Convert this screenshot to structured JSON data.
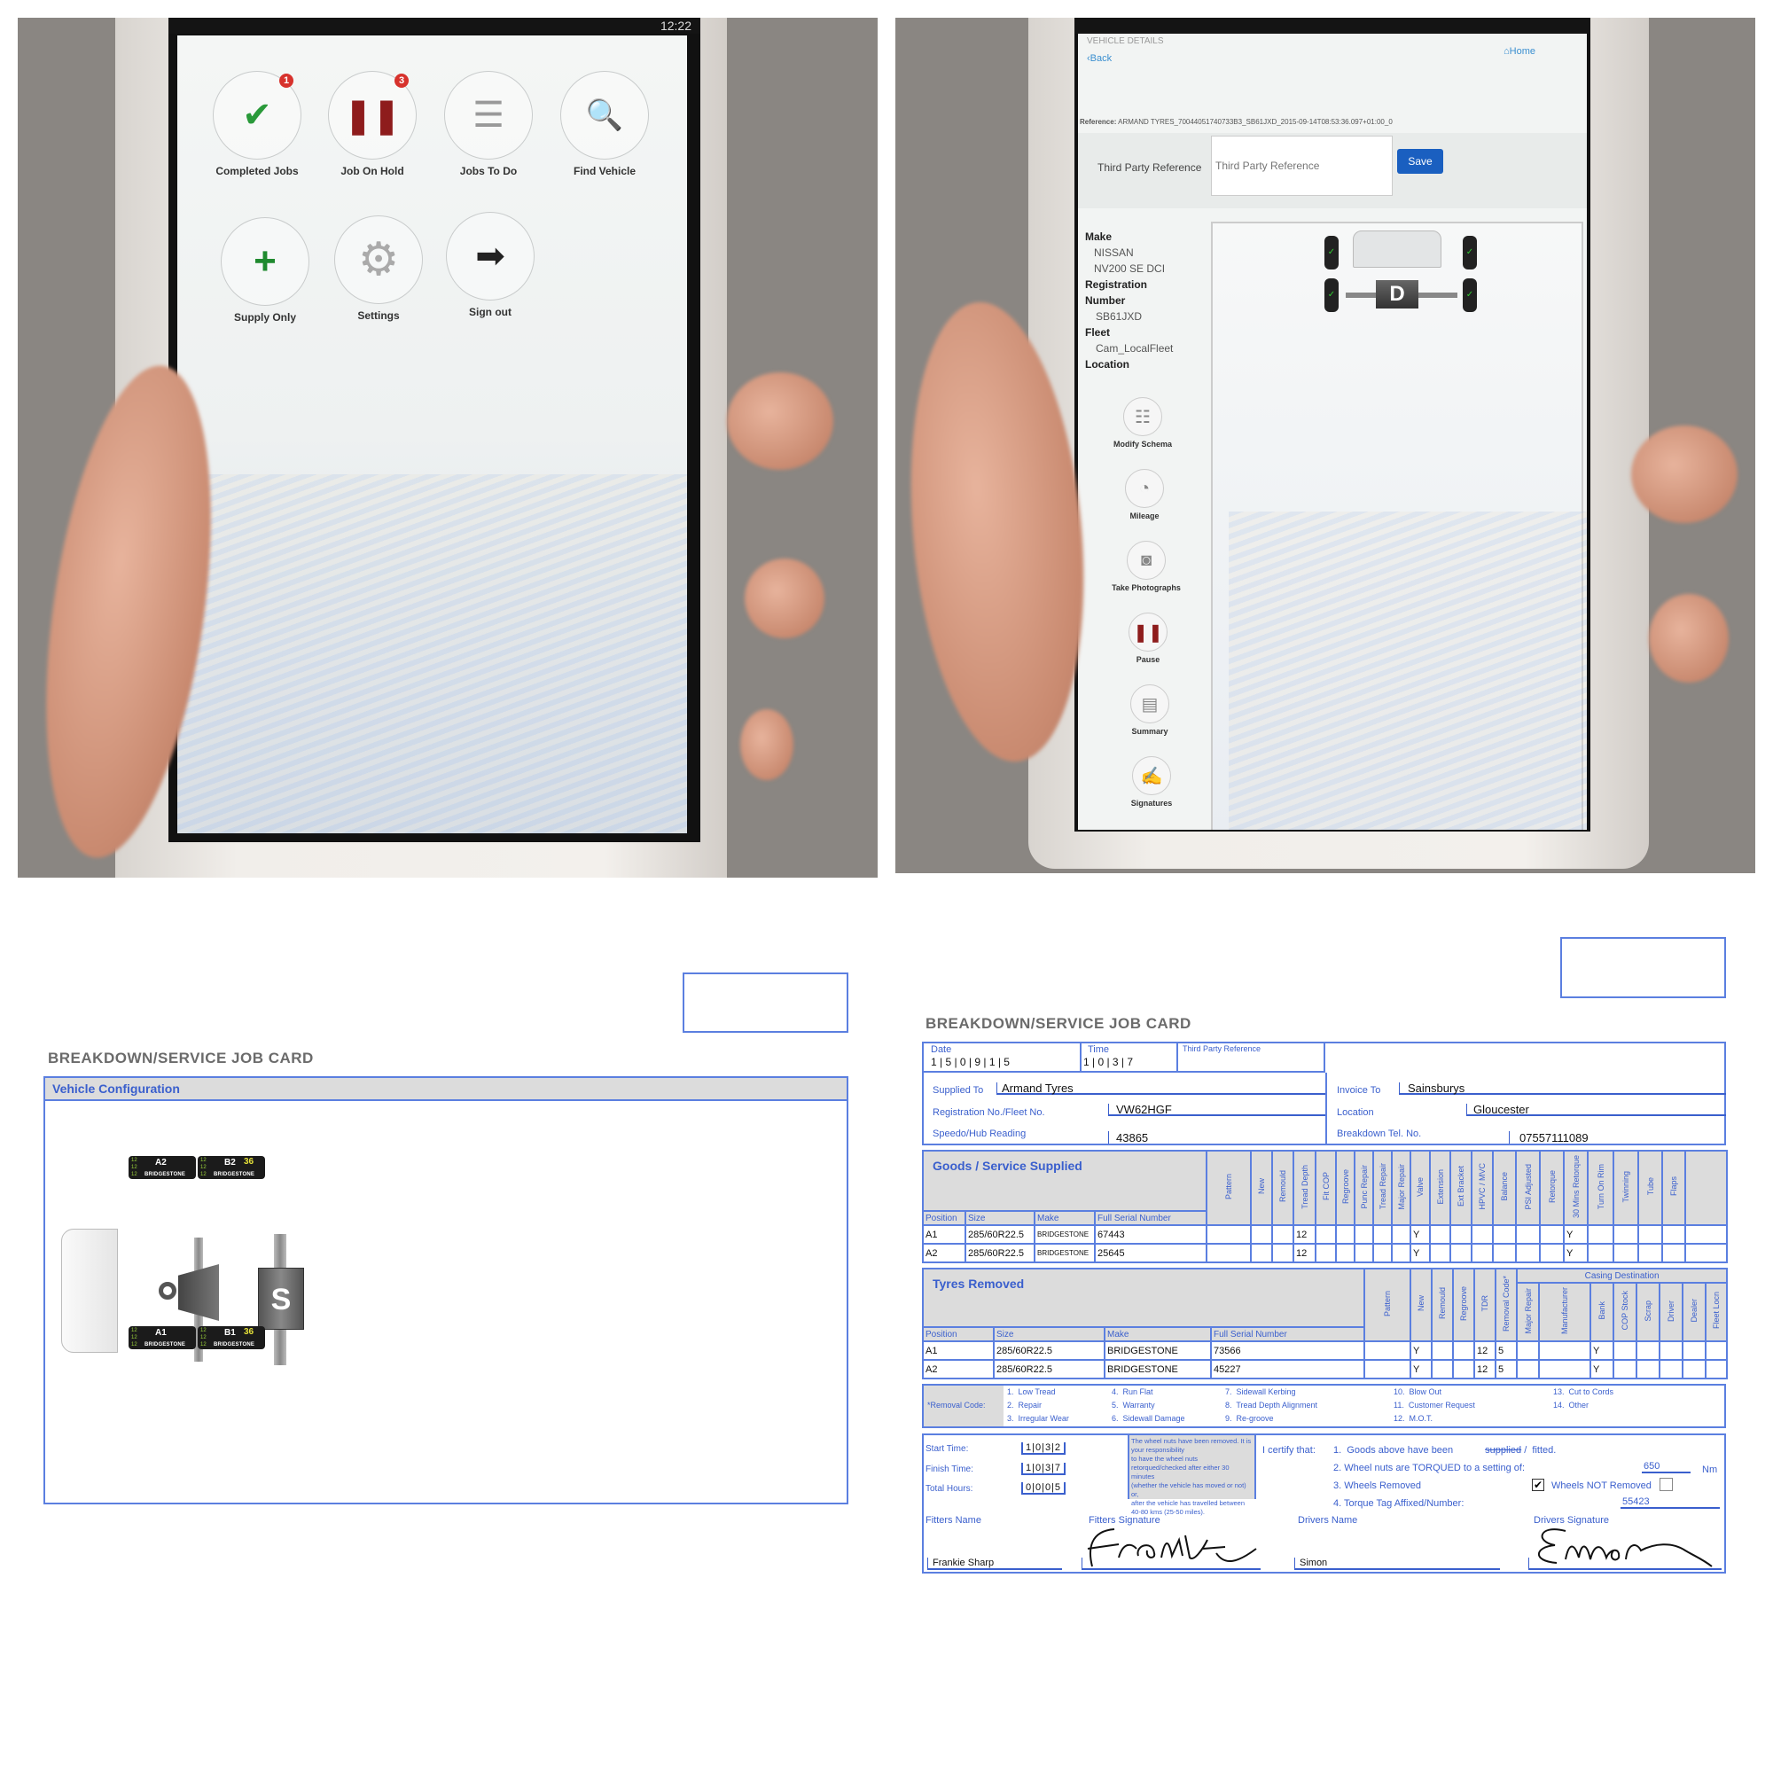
{
  "photo1": {
    "status_time": "12:22",
    "tiles": [
      {
        "label": "Completed Jobs",
        "badge": "1",
        "icon": "clipboard-check-icon"
      },
      {
        "label": "Job On Hold",
        "badge": "3",
        "icon": "clipboard-pause-icon"
      },
      {
        "label": "Jobs To Do",
        "badge": "",
        "icon": "clipboard-list-icon"
      },
      {
        "label": "Find Vehicle",
        "badge": "",
        "icon": "truck-search-icon"
      },
      {
        "label": "Supply Only",
        "badge": "",
        "icon": "clipboard-plus-icon"
      },
      {
        "label": "Settings",
        "badge": "",
        "icon": "gear-icon"
      },
      {
        "label": "Sign out",
        "badge": "",
        "icon": "sign-out-icon"
      }
    ]
  },
  "photo2": {
    "section_title": "VEHICLE DETAILS",
    "back_label": "Back",
    "home_label": "Home",
    "reference_label": "Reference:",
    "reference_value": "ARMAND TYRES_70044051740733B3_SB61JXD_2015-09-14T08:53:36.097+01:00_0",
    "third_party_label": "Third Party Reference",
    "third_party_placeholder": "Third Party Reference",
    "save_label": "Save",
    "save_color": "#1a5fc0",
    "details": {
      "make_label": "Make",
      "make": "NISSAN",
      "model": "NV200 SE DCI",
      "registration_label": "Registration",
      "number_label": "Number",
      "registration": "SB61JXD",
      "fleet_label": "Fleet",
      "fleet": "Cam_LocalFleet",
      "location_label": "Location"
    },
    "actions": [
      "Modify Schema",
      "Mileage",
      "Take Photographs",
      "Pause",
      "Summary",
      "Signatures"
    ],
    "axle_letter": "D"
  },
  "doc1": {
    "title": "BREAKDOWN/SERVICE JOB CARD",
    "section": "Vehicle Configuration",
    "axle_letter": "S",
    "tags": [
      {
        "pos": "A2",
        "pressure": "",
        "depths": [
          "12",
          "12",
          "12"
        ],
        "brand": "BRIDGESTONE"
      },
      {
        "pos": "B2",
        "pressure": "36",
        "depths": [
          "12",
          "12",
          "12"
        ],
        "brand": "BRIDGESTONE"
      },
      {
        "pos": "A1",
        "pressure": "",
        "depths": [
          "12",
          "12",
          "12"
        ],
        "brand": "BRIDGESTONE"
      },
      {
        "pos": "B1",
        "pressure": "36",
        "depths": [
          "12",
          "12",
          "12"
        ],
        "brand": "BRIDGESTONE"
      }
    ]
  },
  "doc2": {
    "title": "BREAKDOWN/SERVICE JOB CARD",
    "header": {
      "date_label": "Date",
      "date": "1 | 5 | 0 | 9 | 1 | 5",
      "time_label": "Time",
      "time": "1 | 0 | 3 | 7",
      "third_party_label": "Third Party Reference",
      "supplied_to_label": "Supplied To",
      "supplied_to": "Armand Tyres",
      "invoice_to_label": "Invoice To",
      "invoice_to": "Sainsburys",
      "registration_label": "Registration No./Fleet No.",
      "registration": "VW62HGF",
      "location_label": "Location",
      "location": "Gloucester",
      "speedo_label": "Speedo/Hub Reading",
      "speedo": "43865",
      "tel_label": "Breakdown Tel. No.",
      "tel": "07557111089"
    },
    "goods": {
      "title": "Goods / Service Supplied",
      "base_columns": [
        "Position",
        "Size",
        "Make",
        "Full Serial Number"
      ],
      "service_columns": [
        "Pattern",
        "New",
        "Remould",
        "Tread Depth",
        "Fit COP",
        "Regroove",
        "Punc Repair",
        "Tread Repair",
        "Major Repair",
        "Valve",
        "Extension",
        "Ext Bracket",
        "HPVC / MVC",
        "Balance",
        "PSI Adjusted",
        "Retorque",
        "30 Mins Retorque",
        "Turn On Rim",
        "Twinning",
        "Tube",
        "Flaps",
        ""
      ],
      "rows": [
        {
          "cells": [
            "A1",
            "285/60R22.5",
            "BRIDGESTONE",
            "67443",
            "",
            "",
            "",
            "12",
            "",
            "",
            "",
            "",
            "",
            "Y",
            "",
            "",
            "",
            "",
            "",
            "",
            "Y",
            "",
            "",
            "",
            "",
            ""
          ]
        },
        {
          "cells": [
            "A2",
            "285/60R22.5",
            "BRIDGESTONE",
            "25645",
            "",
            "",
            "",
            "12",
            "",
            "",
            "",
            "",
            "",
            "Y",
            "",
            "",
            "",
            "",
            "",
            "",
            "Y",
            "",
            "",
            "",
            "",
            ""
          ]
        }
      ]
    },
    "removed": {
      "title": "Tyres Removed",
      "base_columns": [
        "Position",
        "Size",
        "Make",
        "Full Serial Number"
      ],
      "columns": [
        "Pattern",
        "New",
        "Remould",
        "Regroove",
        "TDR",
        "Removal Code*"
      ],
      "casing_title": "Casing Destination",
      "casing_columns": [
        "Major Repair",
        "Manufacturer",
        "Bank",
        "COP Stock",
        "Scrap",
        "Driver",
        "Dealer",
        "Fleet Locn"
      ],
      "rows": [
        {
          "cells": [
            "A1",
            "285/60R22.5",
            "BRIDGESTONE",
            "73566",
            "",
            "Y",
            "",
            "",
            "12",
            "5",
            "",
            "",
            "Y",
            "",
            "",
            "",
            "",
            ""
          ]
        },
        {
          "cells": [
            "A2",
            "285/60R22.5",
            "BRIDGESTONE",
            "45227",
            "",
            "Y",
            "",
            "",
            "12",
            "5",
            "",
            "",
            "Y",
            "",
            "",
            "",
            "",
            ""
          ]
        }
      ]
    },
    "removal_codes": {
      "label": "*Removal Code:",
      "codes": [
        "1.  Low Tread",
        "2.  Repair",
        "3.  Irregular Wear",
        "4.  Run Flat",
        "5.  Warranty",
        "6.  Sidewall Damage",
        "7.  Sidewall Kerbing",
        "8.  Tread Depth Alignment",
        "9.  Re-groove",
        "10.  Blow Out",
        "11.  Customer Request",
        "12.  M.O.T.",
        "13.  Cut to Cords",
        "14.  Other"
      ]
    },
    "footer": {
      "start_label": "Start Time:",
      "start": "1|0|3|2",
      "finish_label": "Finish Time:",
      "finish": "1|0|3|7",
      "total_label": "Total Hours:",
      "total": "0|0|0|5",
      "notice": [
        "The wheel nuts have been removed.  It is your responsibility",
        "to have the wheel nuts retorqued/checked after either 30 minutes",
        "(whether the vehicle has moved or not) or,",
        "after the vehicle has travelled between 40-80 kms (25-50 miles)."
      ],
      "certify_label": "I certify that:",
      "cert1": "1.  Goods above have been",
      "cert1_struck": "supplied",
      "cert1_end": "/  fitted.",
      "cert2": "2.  Wheel nuts are TORQUED to a setting of:",
      "torque": "650",
      "torque_unit": "Nm",
      "cert3": "3.  Wheels Removed",
      "wheels_removed": true,
      "wheels_not_removed_label": "Wheels NOT Removed",
      "wheels_not_removed": false,
      "cert4": "4.  Torque Tag Affixed/Number:",
      "tag_number": "55423",
      "fitters_name_label": "Fitters Name",
      "fitters_name": "Frankie Sharp",
      "fitters_signature_label": "Fitters Signature",
      "drivers_name_label": "Drivers Name",
      "drivers_name": "Simon",
      "drivers_signature_label": "Drivers Signature"
    }
  }
}
